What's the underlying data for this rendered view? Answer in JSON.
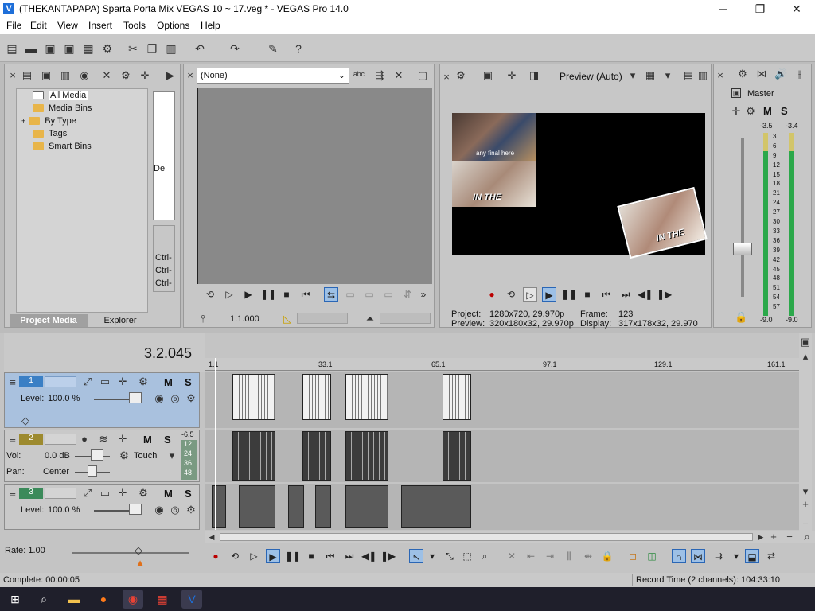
{
  "window": {
    "title": "(THEKANTAPAPA) Sparta Porta Mix VEGAS 10 ~ 17.veg * - VEGAS Pro 14.0",
    "controls": {
      "minimize": "─",
      "maximize": "❐",
      "close": "✕"
    }
  },
  "menu": [
    "File",
    "Edit",
    "View",
    "Insert",
    "Tools",
    "Options",
    "Help"
  ],
  "project_media": {
    "tree": [
      {
        "label": "All Media",
        "selected": true
      },
      {
        "label": "Media Bins"
      },
      {
        "label": "By Type",
        "expandable": "+"
      },
      {
        "label": "Tags"
      },
      {
        "label": "Smart Bins"
      }
    ],
    "tabs": [
      "Project Media",
      "Explorer"
    ],
    "side_labels": [
      "De",
      "Ctrl-",
      "Ctrl-",
      "Ctrl-"
    ]
  },
  "trimmer": {
    "dropdown_value": "(None)",
    "timecode": "1.1.000"
  },
  "preview": {
    "mode": "Preview (Auto)",
    "info": {
      "project_label": "Project:",
      "project_value": "1280x720, 29.970p",
      "preview_label": "Preview:",
      "preview_value": "320x180x32, 29.970p",
      "frame_label": "Frame:",
      "frame_value": "123",
      "display_label": "Display:",
      "display_value": "317x178x32, 29.970"
    },
    "overlay_texts": [
      "any final here",
      "IN THE",
      "IN THE"
    ]
  },
  "master": {
    "title": "Master",
    "m": "M",
    "s": "S",
    "peak_left": "-3.5",
    "peak_right": "-3.4",
    "scale": [
      "3",
      "6",
      "9",
      "12",
      "15",
      "18",
      "21",
      "24",
      "27",
      "30",
      "33",
      "36",
      "39",
      "42",
      "45",
      "48",
      "51",
      "54",
      "57"
    ],
    "bottom_left": "-9.0",
    "bottom_right": "-9.0"
  },
  "timeline": {
    "timecode": "3.2.045",
    "ruler": [
      "1.1",
      "33.1",
      "65.1",
      "97.1",
      "129.1",
      "161.1"
    ],
    "tracks": [
      {
        "num": "1",
        "level_label": "Level:",
        "level_value": "100.0 %",
        "m": "M",
        "s": "S"
      },
      {
        "num": "2",
        "vol_label": "Vol:",
        "vol_value": "0.0 dB",
        "pan_label": "Pan:",
        "pan_value": "Center",
        "mode": "Touch",
        "m": "M",
        "s": "S",
        "peak": "-6.5",
        "scale": [
          "12",
          "24",
          "36",
          "48"
        ]
      },
      {
        "num": "3",
        "level_label": "Level:",
        "level_value": "100.0 %",
        "m": "M",
        "s": "S"
      }
    ],
    "rate_label": "Rate: 1.00"
  },
  "status": {
    "left": "Complete: 00:00:05",
    "right": "Record Time (2 channels): 104:33:10"
  },
  "colors": {
    "accent": "#1e6fd9",
    "selected_track": "#a9c1de",
    "meter_green": "#2ba84a"
  }
}
